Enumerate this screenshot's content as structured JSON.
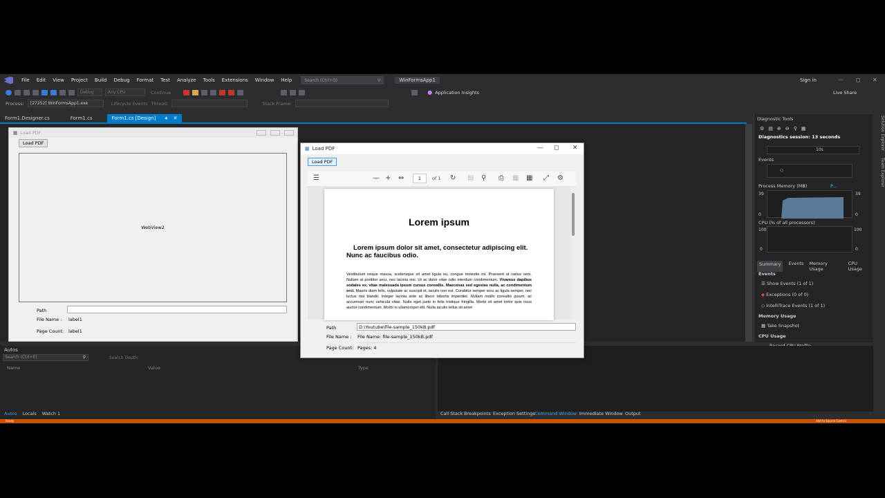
{
  "menubar": {
    "items": [
      "File",
      "Edit",
      "View",
      "Project",
      "Build",
      "Debug",
      "Format",
      "Test",
      "Analyze",
      "Tools",
      "Extensions",
      "Window",
      "Help"
    ],
    "search_placeholder": "Search (Ctrl+Q)",
    "solution_name": "WinFormsApp1",
    "sign_in": "Sign in",
    "live_share": "Live Share"
  },
  "toolbar": {
    "config": "Debug",
    "platform": "Any CPU",
    "continue": "Continue",
    "app_insights": "Application Insights"
  },
  "toolbar2": {
    "process_label": "Process:",
    "process_value": "[27252] WinFormsApp1.exe",
    "lifecycle": "Lifecycle Events",
    "thread": "Thread:",
    "stack_frame": "Stack Frame:"
  },
  "tabs": [
    "Form1.Designer.cs",
    "Form1.cs",
    "Form1.cs [Design]"
  ],
  "designer_form": {
    "title": "Load PDF",
    "load_button": "Load PDF",
    "webview_label": "WebView2",
    "path_label": "Path",
    "filename_label": "File Name :",
    "filename_value": "label1",
    "pagecount_label": "Page Count:",
    "pagecount_value": "label1"
  },
  "diagnostics": {
    "title": "Diagnostic Tools",
    "session": "Diagnostics session: 13 seconds",
    "timeline_tick": "10s",
    "events_header": "Events",
    "memory_header": "Process Memory (MB)",
    "memory_legend": "P...",
    "memory_max": "39",
    "memory_min": "0",
    "cpu_header": "CPU (% of all processors)",
    "cpu_max": "100",
    "cpu_min": "0",
    "tabs": [
      "Summary",
      "Events",
      "Memory Usage",
      "CPU Usage"
    ],
    "events_section": "Events",
    "show_events": "Show Events (1 of 1)",
    "exceptions": "Exceptions (0 of 0)",
    "intellitrace": "IntelliTrace Events (1 of 1)",
    "memory_usage": "Memory Usage",
    "take_snapshot": "Take Snapshot",
    "cpu_usage": "CPU Usage",
    "record_cpu": "Record CPU Profile"
  },
  "sidebar": {
    "solution_explorer": "Solution Explorer",
    "team_explorer": "Team Explorer"
  },
  "autos": {
    "title": "Autos",
    "search_placeholder": "Search (Ctrl+E)",
    "search_depth": "Search Depth:",
    "col_name": "Name",
    "col_value": "Value",
    "col_type": "Type",
    "tabs": [
      "Autos",
      "Locals",
      "Watch 1"
    ]
  },
  "bottom_tabs": [
    "Call Stack",
    "Breakpoints",
    "Exception Settings",
    "Command Window",
    "Immediate Window",
    "Output"
  ],
  "status": {
    "left": "Ready",
    "right": "Add to Source Control"
  },
  "pdf_window": {
    "title": "Load PDF",
    "load_button": "Load PDF",
    "page_number": "1",
    "page_of": "of 1",
    "doc_title": "Lorem ipsum",
    "doc_subtitle": "Lorem ipsum dolor sit amet, consectetur adipiscing elit. Nunc ac faucibus odio.",
    "body_1": "Vestibulum neque massa, scelerisque sit amet ligula eu, congue molestie mi. Praesent ut varius sem. Nullam at porttitor arcu, nec lacinia nisi. Ut ac dolor vitae odio interdum condimentum. ",
    "body_bold": "Vivamus dapibus sodales ex, vitae malesuada ipsum cursus convallis. Maecenas sed egestas nulla, ac condimentum orci.",
    "body_2": " Mauris diam felis, vulputate ac suscipit et, iaculis non est. Curabitur semper arcu ac ligula semper, nec luctus nisl blandit. Integer lacinia ante ac libero lobortis imperdiet. ",
    "body_italic": "Nullam mollis convallis ipsum, ac accumsan nunc vehicula vitae.",
    "body_3": " Nulla eget justo in felis tristique fringilla. Morbi sit amet tortor quis risus auctor condimentum. Morbi in ullamcorper elit. Nulla iaculis tellus sit amet",
    "path_label": "Path",
    "path_value": "D:\\Youtube\\file-sample_150kB.pdf",
    "filename_label": "File Name :",
    "filename_value": "File Name: file-sample_150kB.pdf",
    "pagecount_label": "Page Count:",
    "pagecount_value": "Pages: 4"
  },
  "colors": {
    "accent": "#007acc",
    "status_bar": "#ca5100",
    "ide_bg": "#2d2d30"
  }
}
